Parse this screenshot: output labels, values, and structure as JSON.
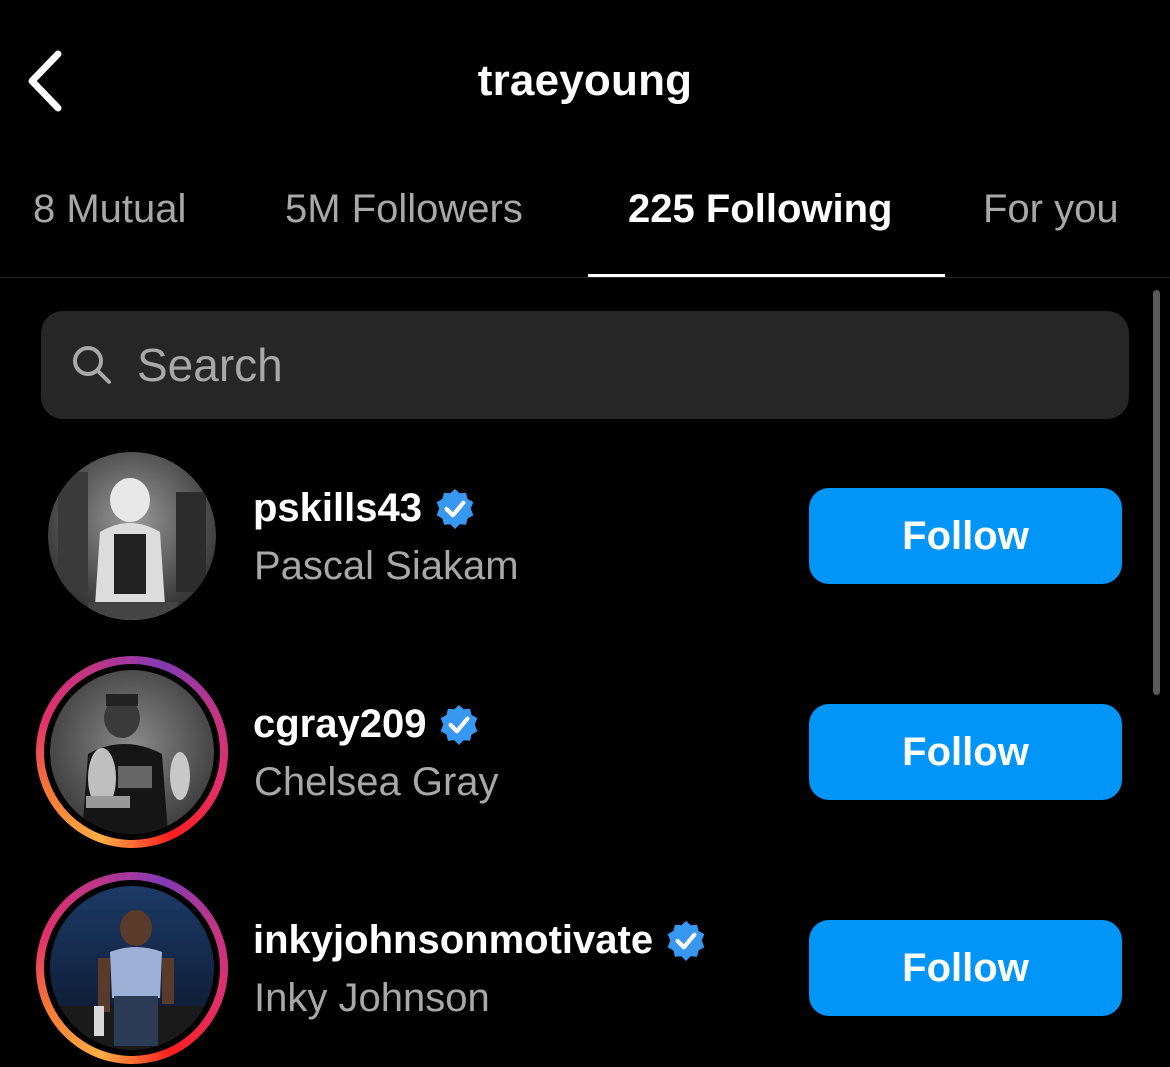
{
  "header": {
    "title": "traeyoung",
    "back_icon": "chevron-left-icon"
  },
  "tabs": [
    {
      "label": "8 Mutual",
      "active": false
    },
    {
      "label": "5M Followers",
      "active": false
    },
    {
      "label": "225 Following",
      "active": true
    },
    {
      "label": "For you",
      "active": false
    }
  ],
  "search": {
    "placeholder": "Search",
    "value": "",
    "icon": "search-icon"
  },
  "following": [
    {
      "username": "pskills43",
      "full_name": "Pascal Siakam",
      "verified": true,
      "story_ring": false,
      "button_label": "Follow"
    },
    {
      "username": "cgray209",
      "full_name": "Chelsea Gray",
      "verified": true,
      "story_ring": true,
      "button_label": "Follow"
    },
    {
      "username": "inkyjohnsonmotivate",
      "full_name": "Inky Johnson",
      "verified": true,
      "story_ring": true,
      "button_label": "Follow"
    }
  ],
  "colors": {
    "background": "#000000",
    "accent": "#0095f6",
    "verified": "#3897f0",
    "secondary_text": "#a8a8a8",
    "search_bg": "#262626"
  }
}
